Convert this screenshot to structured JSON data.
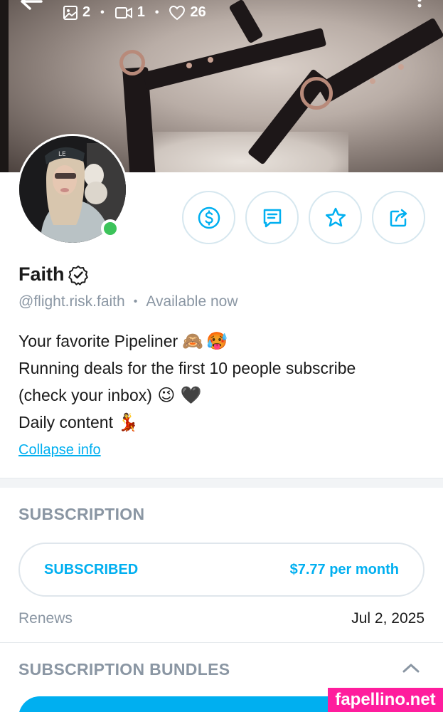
{
  "header": {
    "stats": {
      "photos": "2",
      "videos": "1",
      "likes": "26"
    }
  },
  "profile": {
    "name": "Faith",
    "handle": "@flight.risk.faith",
    "status": "Available now",
    "online": true,
    "bio": {
      "line1": "Your favorite Pipeliner",
      "line1_emojis": [
        "🙈",
        "🥵"
      ],
      "line2": "Running deals for the first 10 people subscribe",
      "line3": "(check your inbox)",
      "line3_emojis": [
        "😉",
        "🖤"
      ],
      "line4": "Daily content",
      "line4_emojis": [
        "💃"
      ]
    },
    "collapse_label": "Collapse info"
  },
  "subscription": {
    "title": "SUBSCRIPTION",
    "state_label": "SUBSCRIBED",
    "price": "$7.77 per month",
    "renews_label": "Renews",
    "renews_date": "Jul 2, 2025"
  },
  "bundles": {
    "title": "SUBSCRIPTION BUNDLES"
  },
  "watermark": "fapellino.net",
  "colors": {
    "accent": "#00aff0",
    "muted": "#8a96a3",
    "online": "#3cc35a",
    "watermark_bg": "#ff1d9d"
  }
}
